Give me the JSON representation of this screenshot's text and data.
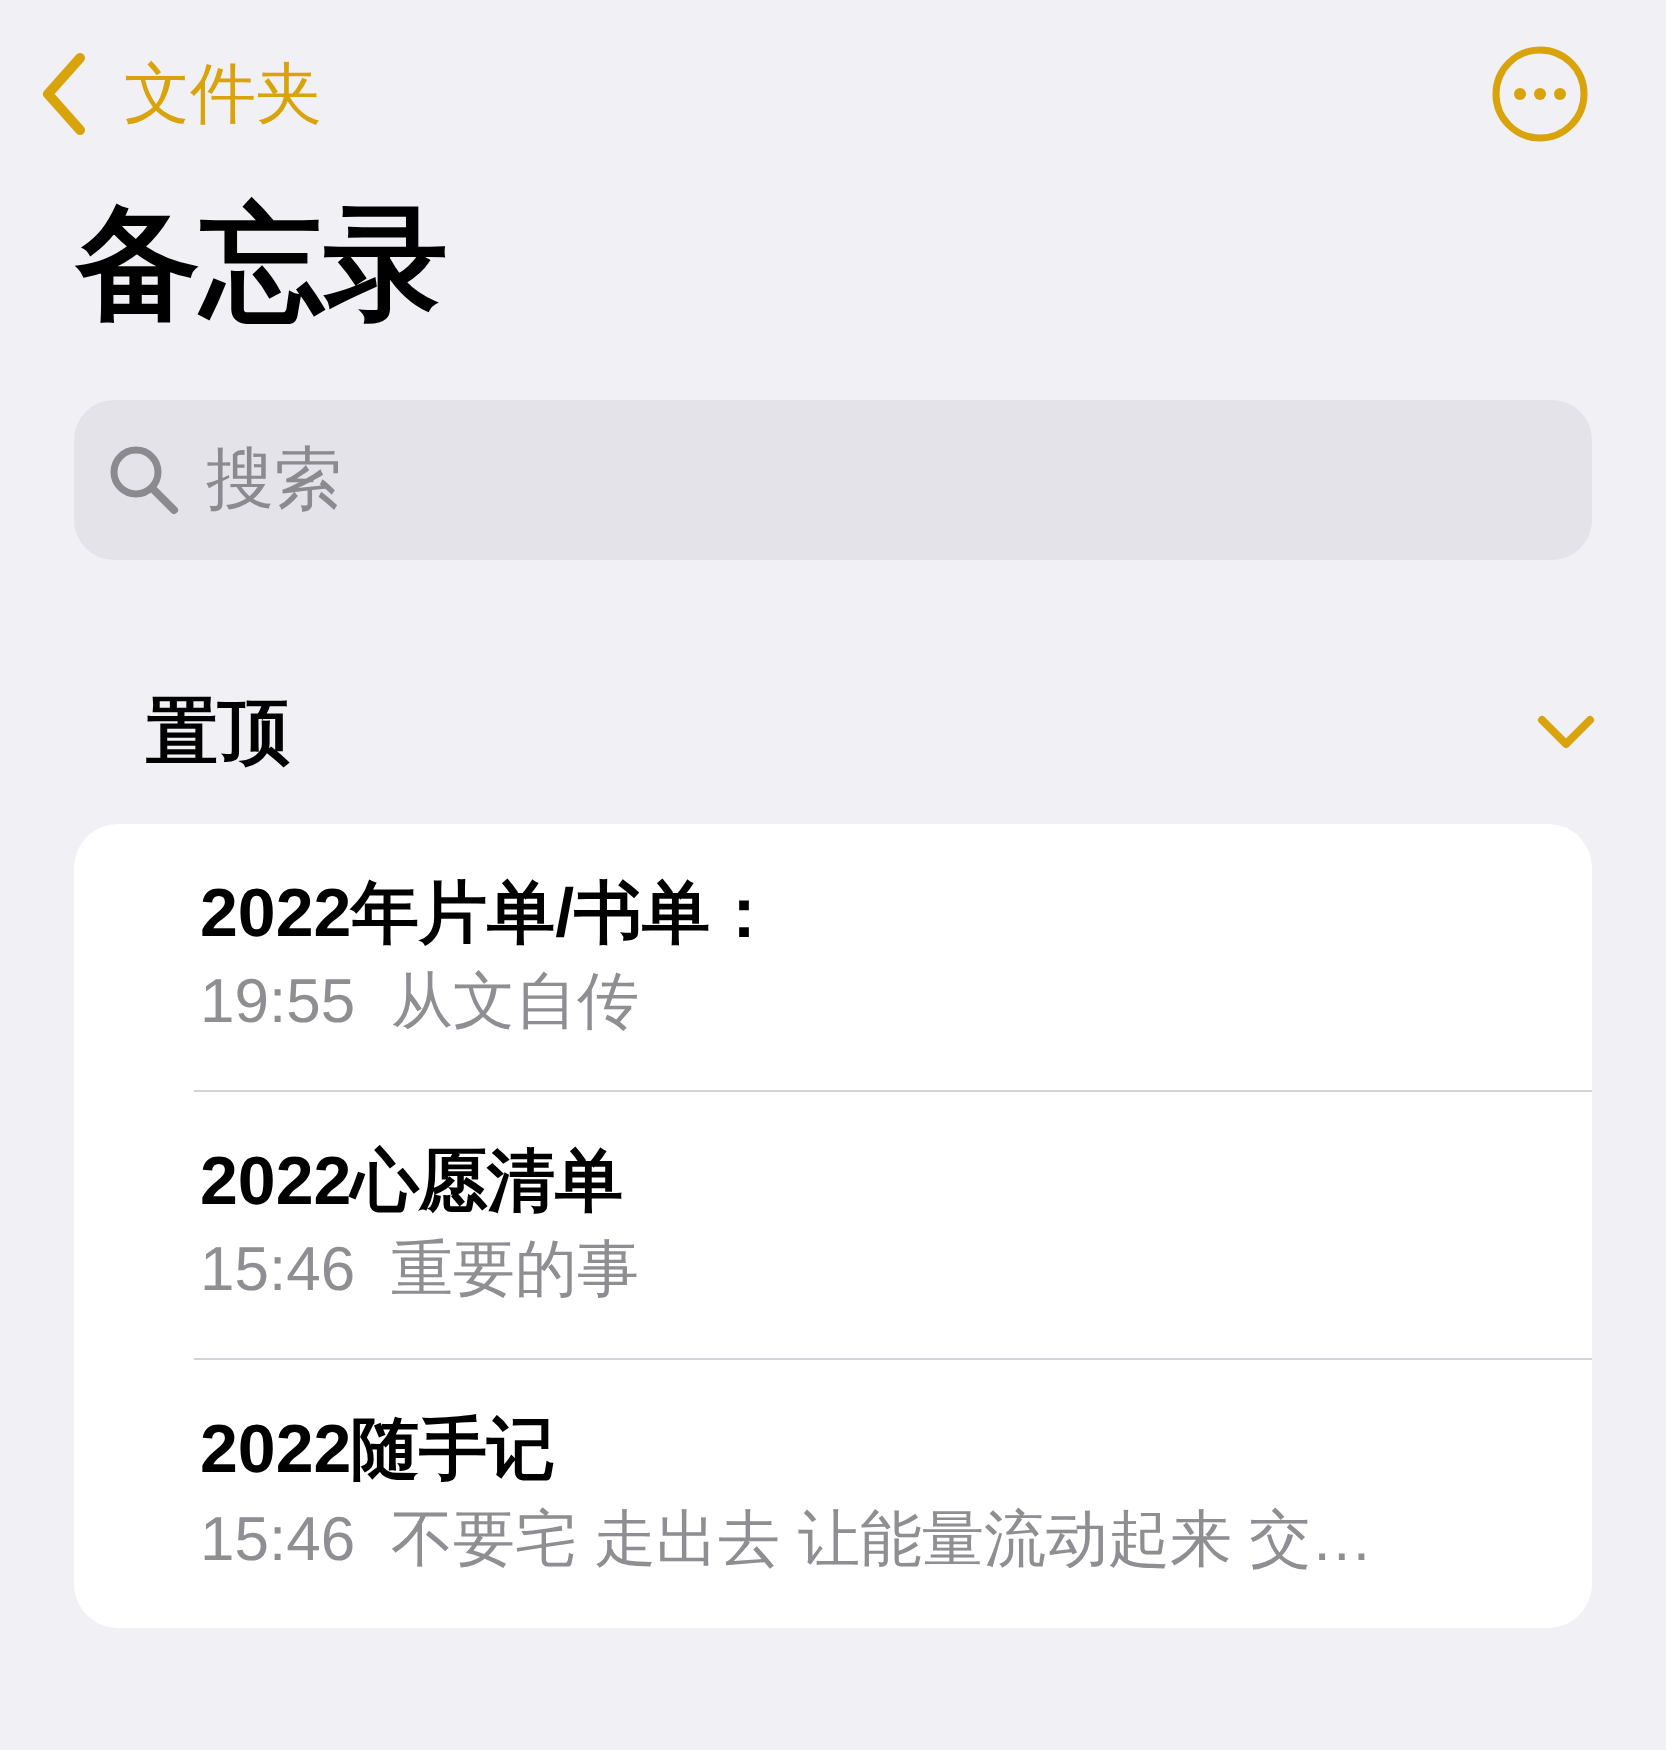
{
  "nav": {
    "back_label": "文件夹"
  },
  "title": "备忘录",
  "search": {
    "placeholder": "搜索"
  },
  "section": {
    "title": "置顶",
    "expanded": true
  },
  "notes": [
    {
      "title": "2022年片单/书单：",
      "time": "19:55",
      "preview": "从文自传"
    },
    {
      "title": "2022心愿清单",
      "time": "15:46",
      "preview": "重要的事"
    },
    {
      "title": "2022随手记",
      "time": "15:46",
      "preview": "不要宅 走出去 让能量流动起来 交…"
    }
  ]
}
